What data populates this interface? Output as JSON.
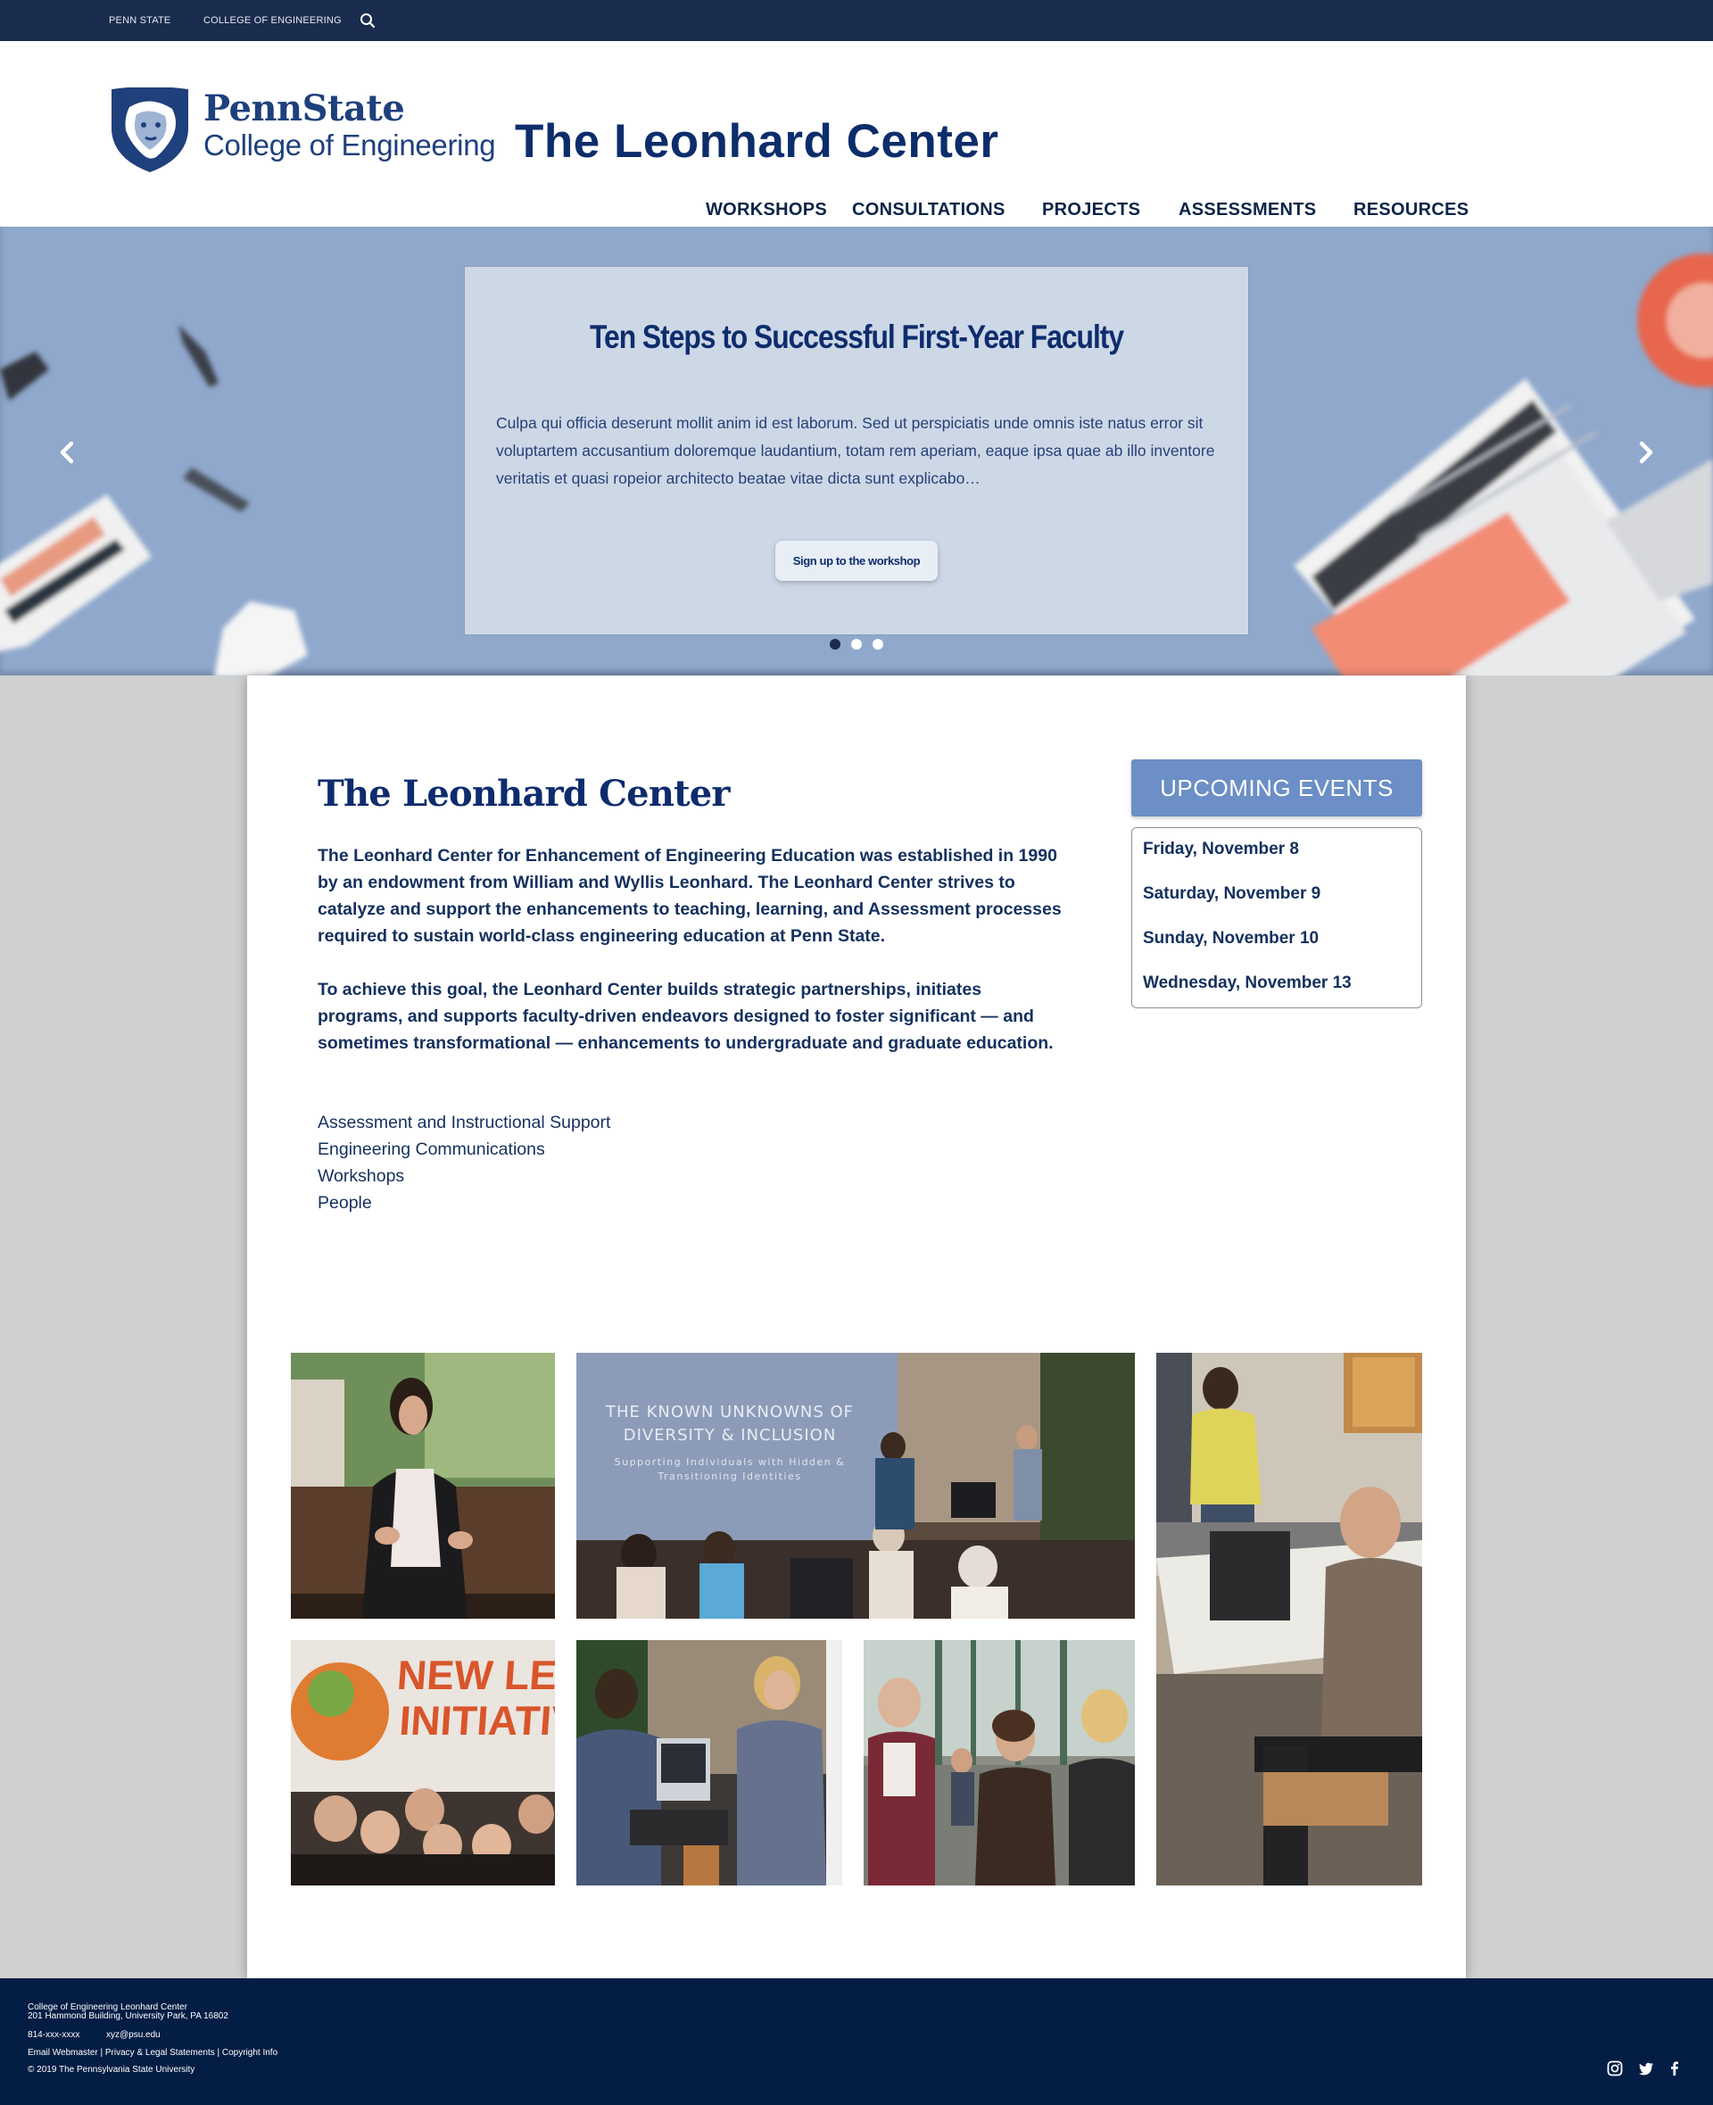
{
  "topbar": {
    "link1": "PENN STATE",
    "link2": "COLLEGE OF ENGINEERING",
    "search_icon": "search-icon"
  },
  "header": {
    "brand_line1": "PennState",
    "brand_line2": "College of Engineering",
    "site_title": "The Leonhard Center",
    "logo_icon": "nittany-lion-shield-icon"
  },
  "nav": {
    "items": [
      "WORKSHOPS",
      "CONSULTATIONS",
      "PROJECTS",
      "ASSESSMENTS",
      "RESOURCES"
    ]
  },
  "hero": {
    "title": "Ten Steps to Successful First-Year Faculty",
    "body": "Culpa qui officia deserunt mollit anim id est laborum. Sed ut perspiciatis unde omnis iste natus error sit voluptartem accusantium doloremque laudantium, totam rem aperiam, eaque ipsa quae ab illo inventore veritatis et quasi ropeior architecto beatae vitae dicta sunt explicabo…",
    "button": "Sign up to the workshop",
    "slide_count": 3,
    "active_slide": 1,
    "prev_icon": "chevron-left-icon",
    "next_icon": "chevron-right-icon"
  },
  "main": {
    "title": "The Leonhard Center",
    "para1": "The Leonhard Center for Enhancement of Engineering Education was established in 1990 by an endowment from William and Wyllis Leonhard. The Leonhard Center strives to catalyze and support the enhancements to teaching, learning, and Assessment processes required to sustain world-class engineering education at Penn State.",
    "para2": "To achieve this goal, the Leonhard Center builds strategic partnerships, initiates programs, and supports faculty-driven endeavors designed to foster significant — and sometimes transformational — enhancements to undergraduate and graduate education.",
    "links": [
      "Assessment and Instructional Support",
      "Engineering Communications",
      "Workshops",
      "People"
    ]
  },
  "events": {
    "header": "UPCOMING EVENTS",
    "items": [
      "Friday, November 8",
      "Saturday, November 9",
      "Sunday, November 10",
      "Wednesday, November 13"
    ]
  },
  "gallery": {
    "slide_title": "THE KNOWN UNKNOWNS OF",
    "slide_title2": "DIVERSITY & INCLUSION",
    "slide_sub": "Supporting Individuals with Hidden &",
    "slide_sub2": "Transitioning Identities",
    "banner_line1": "NEW LEAF",
    "banner_line2": "INITIATIVE"
  },
  "footer": {
    "line1": "College of Engineering  Leonhard Center",
    "line2": "201 Hammond Building, University Park, PA 16802",
    "phone": "814-xxx-xxxx",
    "email": "xyz@psu.edu",
    "links": "Email Webmaster | Privacy & Legal Statements | Copyright Info",
    "copyright": "© 2019 The Pennsylvania State University",
    "social": [
      "instagram-icon",
      "twitter-icon",
      "facebook-icon"
    ]
  },
  "colors": {
    "navy": "#1a2c4e",
    "brand_blue": "#1e407c",
    "hero_bg": "#8fa8cc",
    "events_blue": "#6b8fc6",
    "footer": "#031d44"
  }
}
